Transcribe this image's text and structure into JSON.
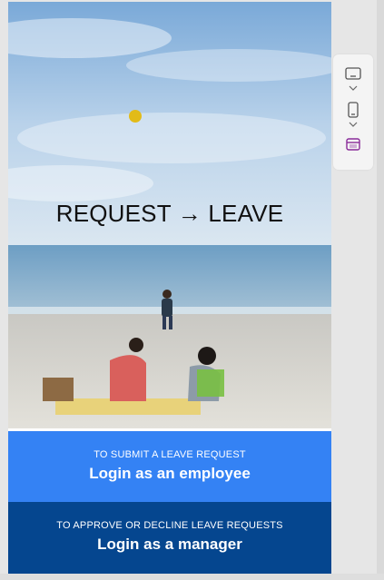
{
  "hero": {
    "title": "REQUEST → LEAVE"
  },
  "employee_login": {
    "caption": "TO SUBMIT A LEAVE REQUEST",
    "label": "Login as an employee"
  },
  "manager_login": {
    "caption": "TO APPROVE OR DECLINE LEAVE REQUESTS",
    "label": "Login as a manager"
  },
  "side_toolbar": {
    "items": [
      "tablet-view-icon",
      "chevron-down-icon",
      "phone-view-icon",
      "chevron-down-icon",
      "web-preview-icon"
    ],
    "active_color": "#8a2b9a"
  },
  "colors": {
    "employee_bg": "#3482f4",
    "manager_bg": "#05468f"
  }
}
